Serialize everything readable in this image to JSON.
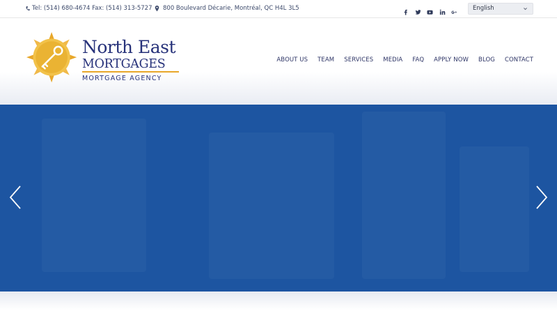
{
  "topbar": {
    "contact_text": "Tel: (514) 680-4674 Fax: (514) 313-5727",
    "address_text": "800 Boulevard Décarie, Montréal, QC H4L 3L5",
    "social_icons": [
      "facebook-icon",
      "twitter-icon",
      "youtube-icon",
      "linkedin-icon",
      "googleplus-icon"
    ],
    "language": "English"
  },
  "brand": {
    "line1": "North East",
    "line2": "MORTGAGES",
    "line3": "MORTGAGE AGENCY",
    "navy": "#27327a",
    "gold": "#e8a72a"
  },
  "nav": {
    "items": [
      "ABOUT US",
      "TEAM",
      "SERVICES",
      "MEDIA",
      "FAQ",
      "APPLY NOW",
      "BLOG",
      "CONTACT"
    ]
  },
  "hero": {
    "background": "#1d55a1"
  }
}
